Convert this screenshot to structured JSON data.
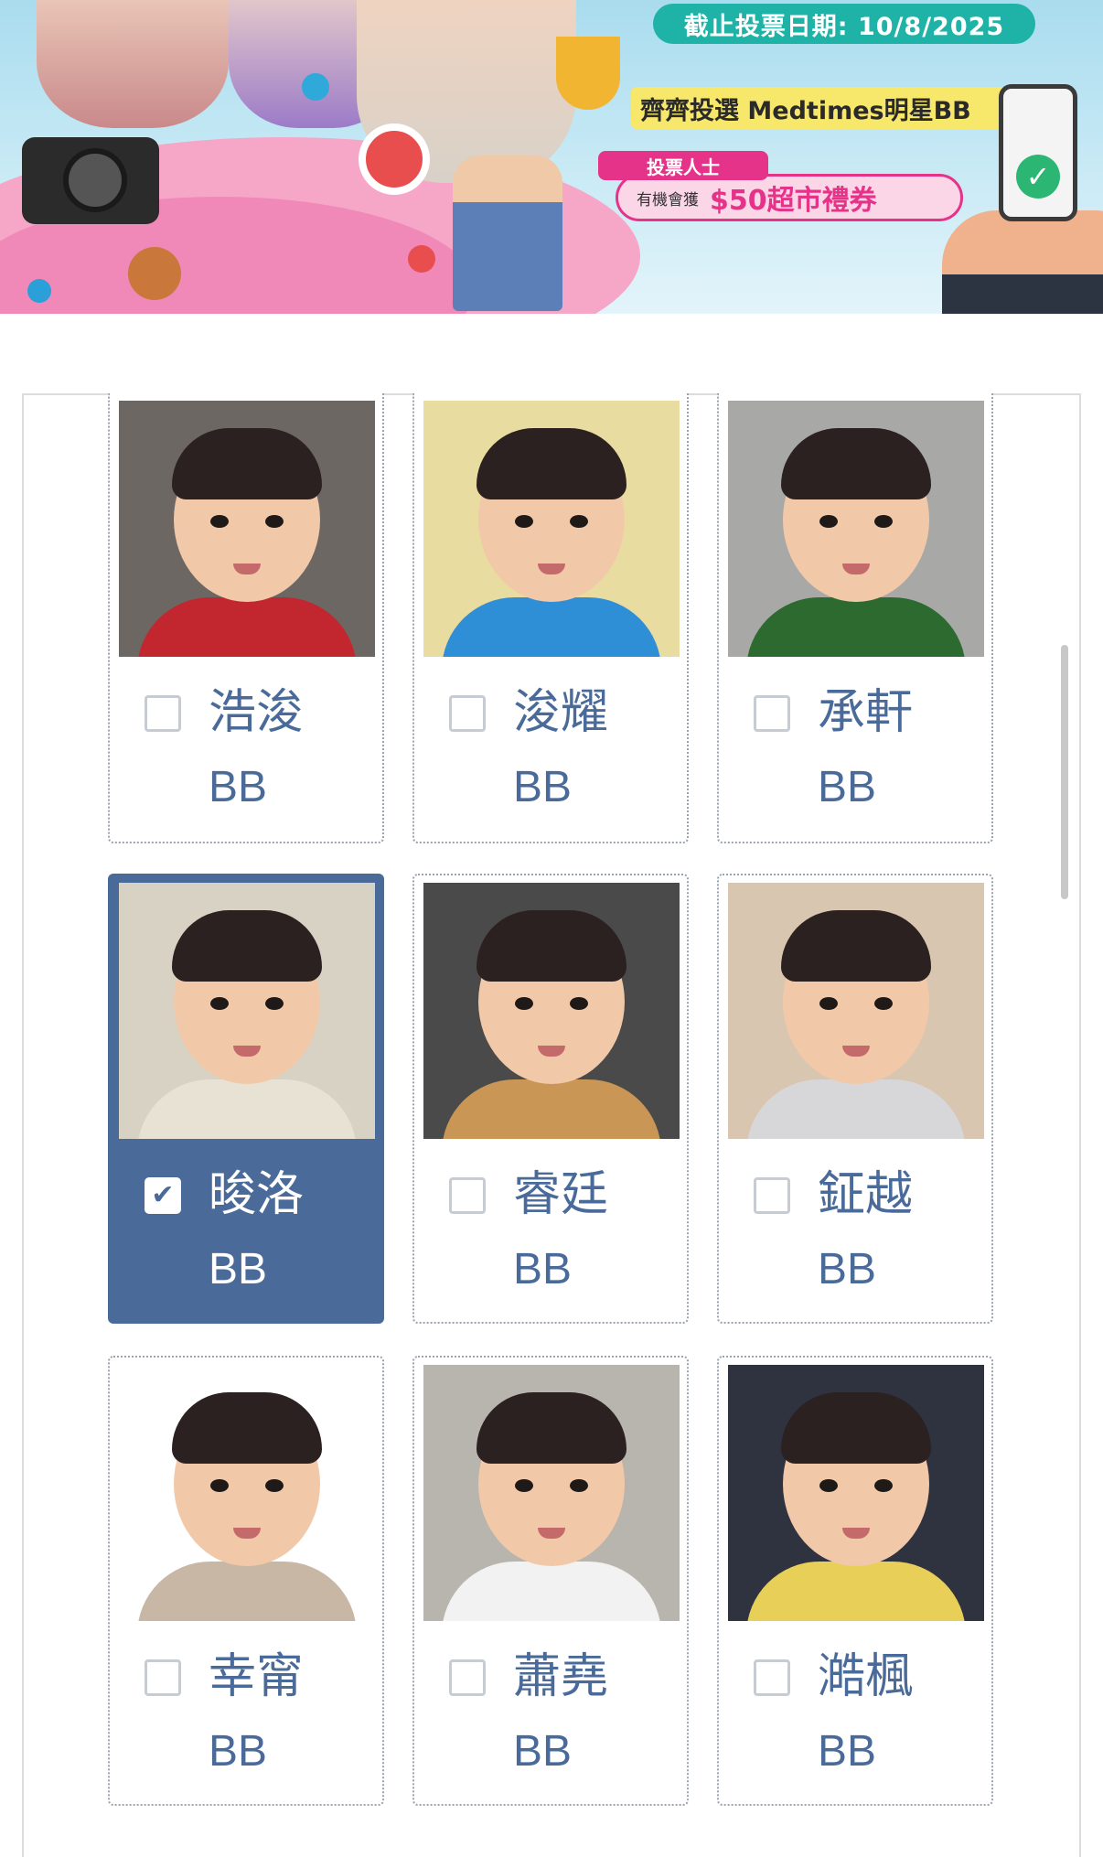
{
  "banner": {
    "deadline_text": "截止投票日期: 10/8/2025",
    "vote_title": "齊齊投選 Medtimes明星BB",
    "voter_tag": "投票人士",
    "prize_prefix": "有機會獲",
    "prize_amount": "$50超市禮券"
  },
  "accent_color": "#4a6b9a",
  "cards": [
    {
      "name": "浩浚",
      "suffix": "BB",
      "checked": false,
      "bg": "#6d6763",
      "shirt": "#c2262e"
    },
    {
      "name": "浚耀",
      "suffix": "BB",
      "checked": false,
      "bg": "#e8dca0",
      "shirt": "#2f8fd6"
    },
    {
      "name": "承軒",
      "suffix": "BB",
      "checked": false,
      "bg": "#a8a8a6",
      "shirt": "#2d6a2f"
    },
    {
      "name": "晙洛",
      "suffix": "BB",
      "checked": true,
      "bg": "#d8d2c4",
      "shirt": "#e8e2d4"
    },
    {
      "name": "睿廷",
      "suffix": "BB",
      "checked": false,
      "bg": "#4a4a4a",
      "shirt": "#c99656"
    },
    {
      "name": "鉦越",
      "suffix": "BB",
      "checked": false,
      "bg": "#d9c6b0",
      "shirt": "#d7d7d9"
    },
    {
      "name": "幸甯",
      "suffix": "BB",
      "checked": false,
      "bg": "#ffffff",
      "shirt": "#c8b7a4"
    },
    {
      "name": "蕭堯",
      "suffix": "BB",
      "checked": false,
      "bg": "#b8b4ae",
      "shirt": "#f2f2f2"
    },
    {
      "name": "澔楓",
      "suffix": "BB",
      "checked": false,
      "bg": "#2f3340",
      "shirt": "#e8cf58"
    }
  ]
}
